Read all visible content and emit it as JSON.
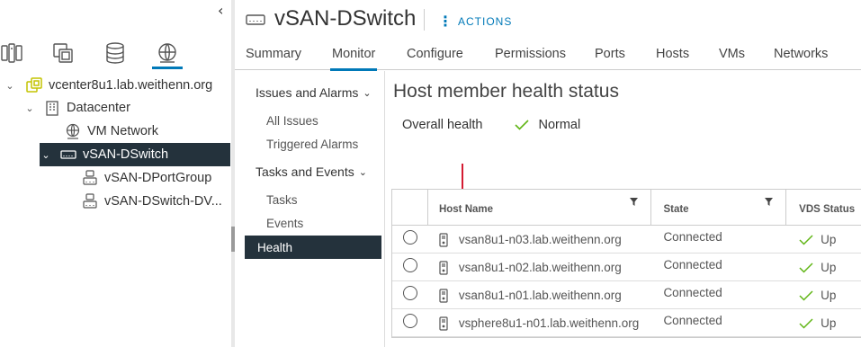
{
  "navigator": {
    "collapse_glyph": "‹",
    "tabs": [
      {
        "name": "hosts-clusters",
        "icon": "hosts-clusters-icon"
      },
      {
        "name": "vms-templates",
        "icon": "vms-templates-icon"
      },
      {
        "name": "storage",
        "icon": "storage-icon"
      },
      {
        "name": "networking",
        "icon": "networking-icon",
        "active": true
      }
    ],
    "tree": [
      {
        "label": "vcenter8u1.lab.weithenn.org",
        "icon": "vcenter-icon",
        "expanded": true
      },
      {
        "label": "Datacenter",
        "icon": "datacenter-icon",
        "expanded": true
      },
      {
        "label": "VM Network",
        "icon": "network-icon"
      },
      {
        "label": "vSAN-DSwitch",
        "icon": "dswitch-icon",
        "expanded": true,
        "selected": true
      },
      {
        "label": "vSAN-DPortGroup",
        "icon": "portgroup-icon"
      },
      {
        "label": "vSAN-DSwitch-DV...",
        "icon": "portgroup-icon"
      }
    ]
  },
  "header": {
    "title": "vSAN-DSwitch",
    "actions_label": "ACTIONS",
    "tabs": [
      "Summary",
      "Monitor",
      "Configure",
      "Permissions",
      "Ports",
      "Hosts",
      "VMs",
      "Networks"
    ],
    "active_tab": "Monitor"
  },
  "monitor_nav": {
    "groups": [
      {
        "label": "Issues and Alarms",
        "items": [
          "All Issues",
          "Triggered Alarms"
        ]
      },
      {
        "label": "Tasks and Events",
        "items": [
          "Tasks",
          "Events"
        ]
      }
    ],
    "selected_item": "Health"
  },
  "content": {
    "title": "Host member health status",
    "overall_health_label": "Overall health",
    "overall_health_value": "Normal",
    "grid": {
      "columns": [
        "Host Name",
        "State",
        "VDS Status"
      ],
      "rows": [
        {
          "host": "vsan8u1-n03.lab.weithenn.org",
          "state": "Connected",
          "vds_status": "Up"
        },
        {
          "host": "vsan8u1-n02.lab.weithenn.org",
          "state": "Connected",
          "vds_status": "Up"
        },
        {
          "host": "vsan8u1-n01.lab.weithenn.org",
          "state": "Connected",
          "vds_status": "Up"
        },
        {
          "host": "vsphere8u1-n01.lab.weithenn.org",
          "state": "Connected",
          "vds_status": "Up"
        }
      ]
    }
  },
  "colors": {
    "accent": "#0079b8",
    "selected_bg": "#24323c",
    "success": "#60b515",
    "vcenter_icon": "#c4c400",
    "annotation_arrow": "#d0021b"
  }
}
